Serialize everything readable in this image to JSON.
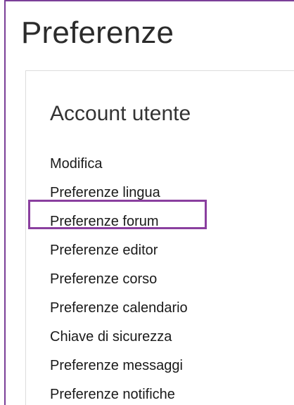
{
  "page": {
    "title": "Preferenze"
  },
  "account": {
    "title": "Account utente",
    "items": [
      {
        "label": "Modifica"
      },
      {
        "label": "Preferenze lingua"
      },
      {
        "label": "Preferenze forum"
      },
      {
        "label": "Preferenze editor"
      },
      {
        "label": "Preferenze corso"
      },
      {
        "label": "Preferenze calendario"
      },
      {
        "label": "Chiave di sicurezza"
      },
      {
        "label": "Preferenze messaggi"
      },
      {
        "label": "Preferenze notifiche"
      }
    ]
  },
  "colors": {
    "frame_border": "#7b3f98",
    "highlight": "#8a3f9f",
    "panel_border": "#dcdcdc",
    "text": "#1a1a1a"
  }
}
